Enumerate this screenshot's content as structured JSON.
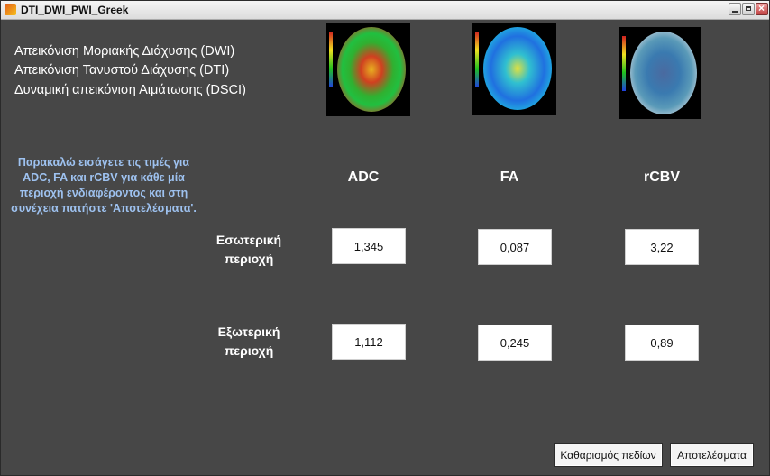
{
  "window": {
    "title": "DTI_DWI_PWI_Greek"
  },
  "headings": [
    "Απεικόνιση Μοριακής Διάχυσης (DWI)",
    "Απεικόνιση Τανυστού Διάχυσης (DTI)",
    "Δυναμική απεικόνιση Αιμάτωσης (DSCI)"
  ],
  "instructions": "Παρακαλώ εισάγετε τις τιμές για ADC, FA και rCBV για κάθε μία περιοχή ενδιαφέροντος και στη συνέχεια πατήστε 'Αποτελέσματα'.",
  "columns": [
    "ADC",
    "FA",
    "rCBV"
  ],
  "rows": [
    {
      "label_line1": "Εσωτερική",
      "label_line2": "περιοχή",
      "values": [
        "1,345",
        "0,087",
        "3,22"
      ]
    },
    {
      "label_line1": "Εξωτερική",
      "label_line2": "περιοχή",
      "values": [
        "1,112",
        "0,245",
        "0,89"
      ]
    }
  ],
  "buttons": {
    "clear": "Καθαρισμός πεδίων",
    "results": "Αποτελέσματα"
  }
}
